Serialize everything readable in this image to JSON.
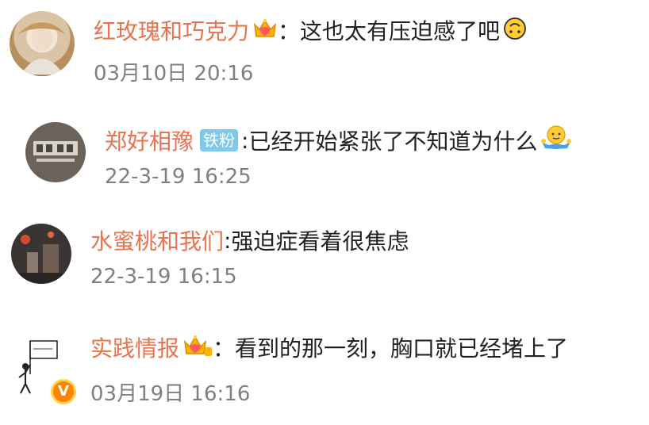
{
  "comments": [
    {
      "username": "红玫瑰和巧克力",
      "separator": "：",
      "text": "这也太有压迫感了吧",
      "time": "03月10日 20:16",
      "icons": [
        "crown-icon",
        "upside-down-smiley-icon"
      ]
    },
    {
      "username": "郑好相豫",
      "fan_badge": "铁粉",
      "separator": ":",
      "text": "已经开始紧张了不知道为什么",
      "time": "22-3-19 16:25",
      "icons": [
        "shrug-emoji-icon"
      ]
    },
    {
      "username": "水蜜桃和我们",
      "separator": ":",
      "text": "强迫症看着很焦虑",
      "time": "22-3-19 16:15"
    },
    {
      "username": "实践情报",
      "separator": "：",
      "text": "看到的那一刻，胸口就已经堵上了",
      "time": "03月19日 16:16",
      "verified_badge": "V",
      "icons": [
        "crown-icon",
        "verified-icon"
      ]
    }
  ],
  "colors": {
    "username": "#e8734f",
    "text": "#222222",
    "time": "#7f7f7f",
    "fan_badge": "#7ec8ea",
    "verified": "#ff8200"
  }
}
